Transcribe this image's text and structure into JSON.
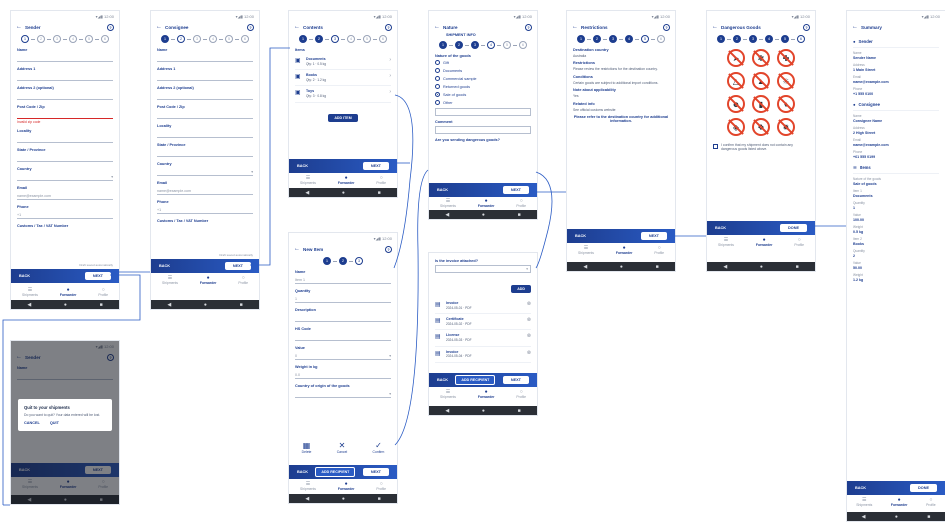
{
  "status_bar_text": "▾◢▮ 12:00",
  "icons": {
    "back": "arrow-left-icon",
    "help": "help-circle-icon",
    "chevron": "chevron-right-icon",
    "dropdown": "chevron-down-icon",
    "list": "list-icon",
    "person": "person-icon",
    "document": "document-icon",
    "check": "check-icon",
    "close": "close-icon",
    "delete": "trash-icon",
    "info": "info-icon",
    "nav_back": "nav-back-icon",
    "nav_home": "nav-home-icon",
    "nav_recent": "nav-recent-icon"
  },
  "colors": {
    "primary": "#1d3d8f",
    "primary_light": "#2a5bc4",
    "error": "#d62828",
    "danger_icon": "#e2452b",
    "connector": "#2a5bc4"
  },
  "common": {
    "back_label": "BACK",
    "next_label": "NEXT",
    "done_label": "DONE",
    "saved_text": "Draft saved automatically",
    "tabs": [
      "Shipments",
      "Forwarder",
      "Profile"
    ],
    "add_recipient_label": "ADD RECIPIENT",
    "add_label": "ADD"
  },
  "screens": {
    "sender": {
      "title": "Sender",
      "fields": [
        {
          "label": "Name",
          "value": ""
        },
        {
          "label": "Address 1",
          "value": ""
        },
        {
          "label": "Address 2 (optional)",
          "value": ""
        },
        {
          "label": "Post Code / Zip",
          "value": "",
          "error": "Invalid zip code"
        },
        {
          "label": "Locality",
          "value": ""
        },
        {
          "label": "State / Province",
          "value": ""
        },
        {
          "label": "Country",
          "value": ""
        },
        {
          "label": "Email",
          "value": "name@example.com"
        },
        {
          "label": "Phone",
          "value": "+1"
        },
        {
          "label": "Customs / Tax / VAT Number",
          "value": ""
        }
      ]
    },
    "consignee": {
      "title": "Consignee",
      "fields": [
        {
          "label": "Name",
          "value": ""
        },
        {
          "label": "Address 1",
          "value": ""
        },
        {
          "label": "Address 2 (optional)",
          "value": ""
        },
        {
          "label": "Post Code / Zip",
          "value": ""
        },
        {
          "label": "Locality",
          "value": ""
        },
        {
          "label": "State / Province",
          "value": ""
        },
        {
          "label": "Country",
          "value": ""
        },
        {
          "label": "Email",
          "value": "name@example.com"
        },
        {
          "label": "Phone",
          "value": "+1"
        },
        {
          "label": "Customs / Tax / VAT Number",
          "value": ""
        }
      ]
    },
    "contents": {
      "title": "Contents",
      "section_label": "Items",
      "items": [
        {
          "name": "Documents",
          "sub": "Qty: 1 · 0.5 kg"
        },
        {
          "name": "Books",
          "sub": "Qty: 2 · 1.2 kg"
        },
        {
          "name": "Toys",
          "sub": "Qty: 3 · 0.8 kg"
        }
      ],
      "add_label": "ADD ITEM"
    },
    "new_item": {
      "title": "New Item",
      "fields": [
        {
          "label": "Name",
          "value": "Item 1"
        },
        {
          "label": "Quantity",
          "value": "1"
        },
        {
          "label": "Description",
          "value": ""
        },
        {
          "label": "HS Code",
          "value": ""
        },
        {
          "label": "Value",
          "value": "0"
        },
        {
          "label": "Weight in kg",
          "value": "0.0"
        },
        {
          "label": "Country of origin of the goods",
          "value": ""
        }
      ],
      "actions": [
        "Delete",
        "Cancel",
        "Confirm"
      ]
    },
    "nature": {
      "title": "Nature",
      "subtitle": "SHIPMENT INFO",
      "question": "Nature of the goods",
      "options": [
        "Gift",
        "Documents",
        "Commercial sample",
        "Returned goods",
        "Sale of goods",
        "Other"
      ],
      "selected_index": 4,
      "comment_label": "Comment",
      "declaration_q": "Are you sending dangerous goods?",
      "invoice_q": "Is the invoice attached?",
      "docs": [
        {
          "name": "Invoice",
          "sub": "2024-05-01 · PDF"
        },
        {
          "name": "Certificate",
          "sub": "2024-05-02 · PDF"
        },
        {
          "name": "License",
          "sub": "2024-05-03 · PDF"
        },
        {
          "name": "Invoice",
          "sub": "2024-05-04 · PDF"
        }
      ]
    },
    "restrictions": {
      "title": "Restrictions",
      "items": [
        {
          "title": "Destination country",
          "value": "Australia"
        },
        {
          "title": "Restrictions",
          "value": "Please review the restrictions for the destination country."
        },
        {
          "title": "Conditions",
          "value": "Certain goods are subject to additional import conditions."
        },
        {
          "title": "Note about applicability",
          "value": "Yes"
        },
        {
          "title": "Related info",
          "value": "See official customs website"
        }
      ],
      "notice": "Please refer to the destination country for additional information."
    },
    "dangerous": {
      "title": "Dangerous Goods",
      "icons": [
        "gun-icon",
        "knife-icon",
        "sword-icon",
        "bottle-icon",
        "spray-icon",
        "fire-icon",
        "person-icon",
        "battery-icon",
        "lighter-icon",
        "acid-icon",
        "drug-icon",
        "explosive-icon"
      ],
      "confirm_text": "I confirm that my shipment does not contain any dangerous goods listed above."
    },
    "summary": {
      "title": "Summary",
      "sections": [
        {
          "label": "Sender",
          "rows": [
            {
              "k": "Name",
              "v": "Sender Name"
            },
            {
              "k": "Address",
              "v": "1 Main Street"
            },
            {
              "k": "Email",
              "v": "name@example.com"
            },
            {
              "k": "Phone",
              "v": "+1 555 0100"
            }
          ]
        },
        {
          "label": "Consignee",
          "rows": [
            {
              "k": "Name",
              "v": "Consignee Name"
            },
            {
              "k": "Address",
              "v": "2 High Street"
            },
            {
              "k": "Email",
              "v": "name@example.com"
            },
            {
              "k": "Phone",
              "v": "+61 555 0199"
            }
          ]
        },
        {
          "label": "Items",
          "rows": [
            {
              "k": "Nature of the goods",
              "v": "Sale of goods"
            },
            {
              "k": "Item 1",
              "v": "Documents"
            },
            {
              "k": "Quantity",
              "v": "1"
            },
            {
              "k": "Value",
              "v": "100.00"
            },
            {
              "k": "Weight",
              "v": "0.5 kg"
            },
            {
              "k": "Item 2",
              "v": "Books"
            },
            {
              "k": "Quantity",
              "v": "2"
            },
            {
              "k": "Value",
              "v": "50.00"
            },
            {
              "k": "Weight",
              "v": "1.2 kg"
            }
          ]
        }
      ]
    },
    "dialog": {
      "title": "Quit to your shipments",
      "body": "Do you want to quit? Your data entered will be lost.",
      "cancel": "CANCEL",
      "ok": "QUIT"
    }
  }
}
